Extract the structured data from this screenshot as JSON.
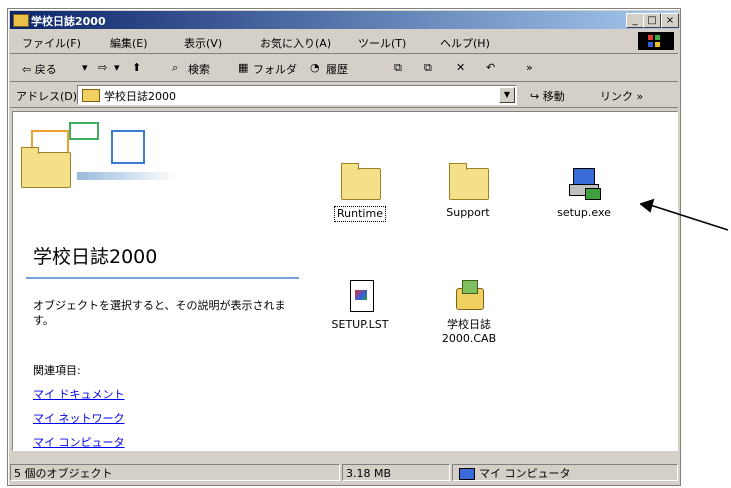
{
  "window": {
    "title": "学校日誌2000"
  },
  "title_buttons": {
    "minimize": "_",
    "maximize": "□",
    "close": "×"
  },
  "menu": [
    "ファイル(F)",
    "編集(E)",
    "表示(V)",
    "お気に入り(A)",
    "ツール(T)",
    "ヘルプ(H)"
  ],
  "toolbar": {
    "back": "⇦ 戻る",
    "back_dd": "▾",
    "forward": "⇨",
    "forward_dd": "▾",
    "up": "⬆",
    "search": "検索",
    "folders": "フォルダ",
    "history": "履歴",
    "delete": "✕",
    "undo": "↶",
    "more": "»"
  },
  "address": {
    "label": "アドレス(D)",
    "value": "学校日誌2000",
    "go": "移動",
    "links": "リンク »"
  },
  "left_panel": {
    "title": "学校日誌2000",
    "description": "オブジェクトを選択すると、その説明が表示されます。",
    "related_label": "関連項目:",
    "links": [
      "マイ ドキュメント",
      "マイ ネットワーク",
      "マイ コンピュータ"
    ]
  },
  "files": [
    {
      "name": "Runtime",
      "icon": "folder-icon"
    },
    {
      "name": "Support",
      "icon": "folder-icon"
    },
    {
      "name": "setup.exe",
      "icon": "setup-exe-icon"
    },
    {
      "name": "SETUP.LST",
      "icon": "lst-file-icon"
    },
    {
      "name": "学校日誌2000.CAB",
      "icon": "cab-file-icon"
    }
  ],
  "status": {
    "count": "5 個のオブジェクト",
    "size": "3.18 MB",
    "location": "マイ コンピュータ"
  }
}
